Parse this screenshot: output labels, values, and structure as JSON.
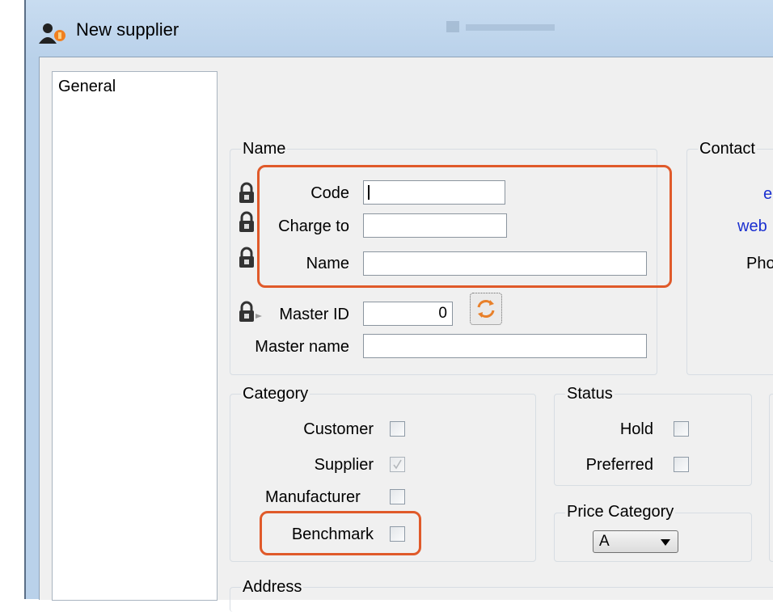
{
  "window": {
    "title": "New supplier"
  },
  "sidebar": {
    "items": [
      "General"
    ]
  },
  "name_group": {
    "legend": "Name",
    "code_label": "Code",
    "code_value": "",
    "charge_to_label": "Charge to",
    "charge_to_value": "",
    "name_label": "Name",
    "name_value": "",
    "master_id_label": "Master ID",
    "master_id_value": "0",
    "master_name_label": "Master name",
    "master_name_value": ""
  },
  "contact_group": {
    "legend": "Contact",
    "email_label": "e",
    "web_label": "web",
    "phone_label": "Pho"
  },
  "category_group": {
    "legend": "Category",
    "customer_label": "Customer",
    "customer_checked": false,
    "supplier_label": "Supplier",
    "supplier_checked": true,
    "manufacturer_label": "Manufacturer",
    "manufacturer_checked": false,
    "benchmark_label": "Benchmark",
    "benchmark_checked": false
  },
  "status_group": {
    "legend": "Status",
    "hold_label": "Hold",
    "hold_checked": false,
    "preferred_label": "Preferred",
    "preferred_checked": false
  },
  "price_category_group": {
    "legend": "Price Category",
    "selected": "A"
  },
  "address_group": {
    "legend": "Address"
  },
  "colors": {
    "highlight": "#e05a2a",
    "link": "#1a2fd0",
    "frame": "#b9d1ea"
  }
}
